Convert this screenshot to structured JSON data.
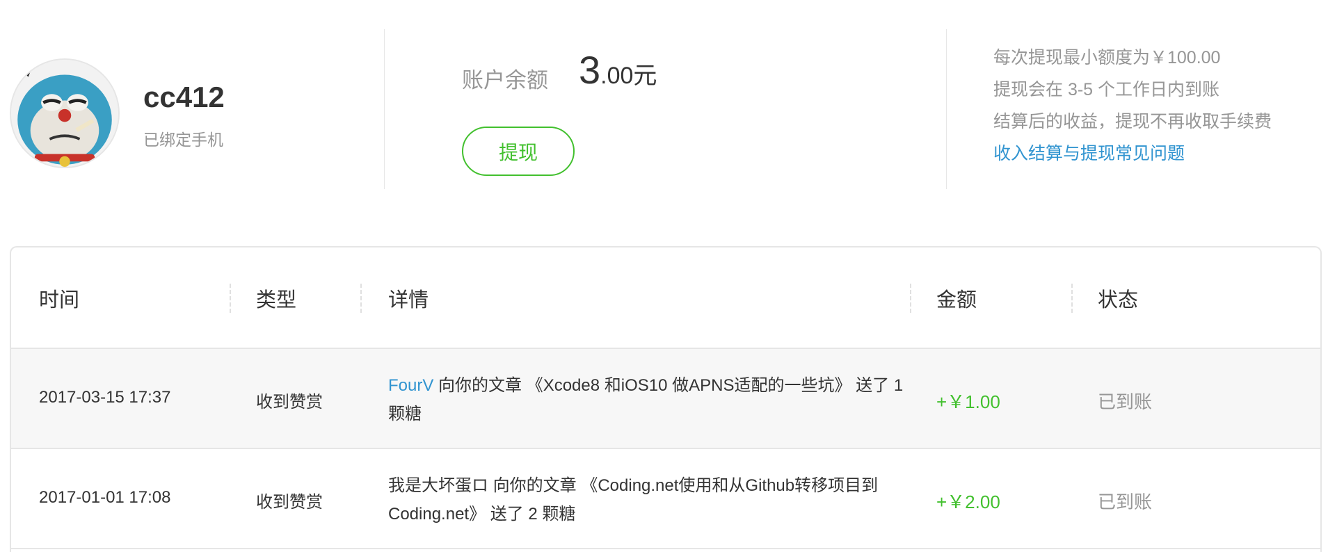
{
  "profile": {
    "username": "cc412",
    "phone_status": "已绑定手机"
  },
  "balance": {
    "label": "账户余额",
    "integer": "3",
    "decimal": ".00",
    "unit": "元",
    "withdraw_label": "提现"
  },
  "notes": {
    "lines": [
      "每次提现最小额度为￥100.00",
      "提现会在 3-5 个工作日内到账",
      "结算后的收益，提现不再收取手续费"
    ],
    "faq_link": "收入结算与提现常见问题"
  },
  "table": {
    "headers": {
      "time": "时间",
      "type": "类型",
      "detail": "详情",
      "amount": "金额",
      "status": "状态"
    },
    "rows": [
      {
        "time": "2017-03-15 17:37",
        "type": "收到赞赏",
        "sender": "FourV",
        "detail_before_break": " 向你的文章 《Xcode8 和iOS10 做APNS适配的一些坑》 送了 1",
        "detail_after_break": "颗糖",
        "amount": "+￥1.00",
        "status": "已到账"
      },
      {
        "time": "2017-01-01 17:08",
        "type": "收到赞赏",
        "sender": "我是大坏蛋ロ",
        "detail_before_break": " 向你的文章 《Coding.net使用和从Github转移项目到",
        "detail_after_break": "Coding.net》 送了 2 颗糖",
        "amount": "+￥2.00",
        "status": "已到账"
      }
    ]
  },
  "colors": {
    "accent_green": "#42c02e",
    "link_blue": "#3194d0",
    "muted_text": "#969696"
  }
}
